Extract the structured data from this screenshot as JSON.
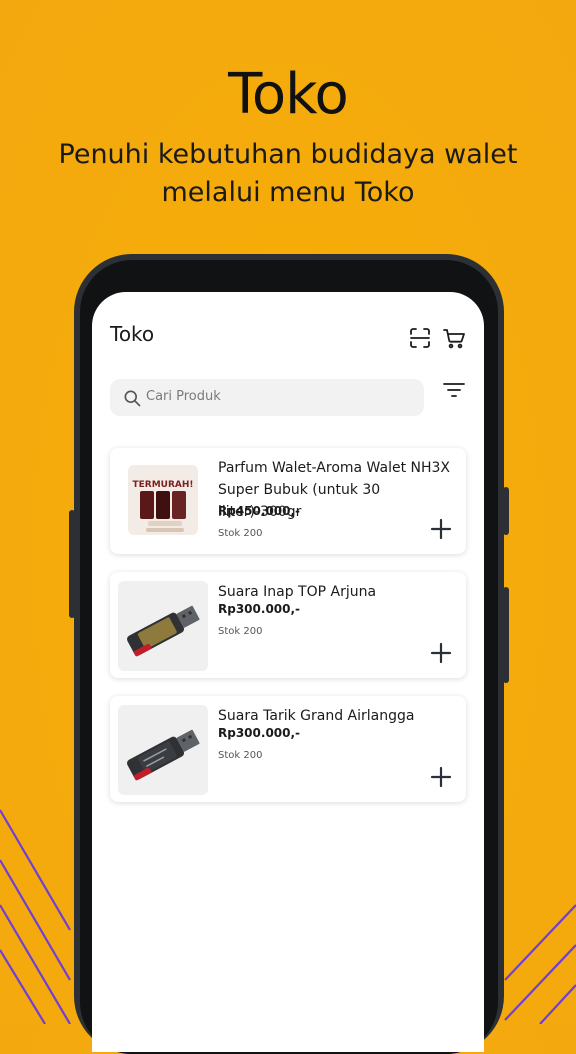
{
  "promo": {
    "title": "Toko",
    "subtitle": "Penuhi kebutuhan budidaya walet melalui menu Toko"
  },
  "app": {
    "title": "Toko",
    "icons": {
      "scan": "scan-icon",
      "cart": "cart-icon",
      "filter": "filter-icon",
      "search": "search-icon",
      "add": "plus-icon"
    },
    "search_placeholder": "Cari Produk"
  },
  "products": [
    {
      "name": "Parfum Walet-Aroma Walet NH3X Super Bubuk (untuk 30 lliter)-300gr",
      "price": "Rp450.000,-",
      "stock": "Stok 200",
      "image_text": "TERMURAH!"
    },
    {
      "name": "Suara Inap TOP Arjuna",
      "price": "Rp300.000,-",
      "stock": "Stok 200"
    },
    {
      "name": "Suara Tarik Grand Airlangga",
      "price": "Rp300.000,-",
      "stock": "Stok 200"
    }
  ],
  "colors": {
    "background": "#f5ac0a",
    "accent_line": "#6f3fd6",
    "phone_frame": "#2c2f33"
  }
}
